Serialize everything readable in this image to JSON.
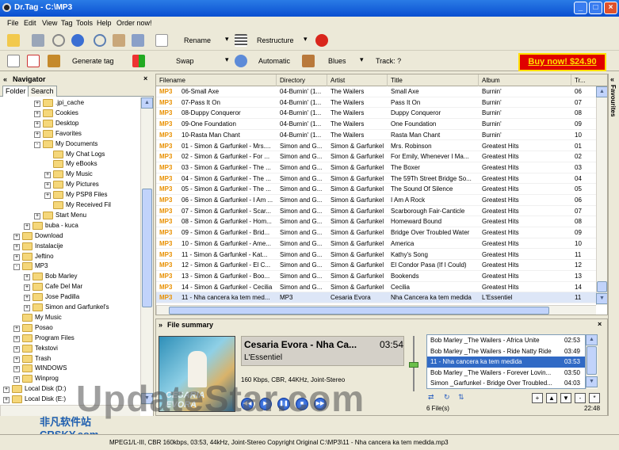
{
  "window": {
    "title": "Dr.Tag - C:\\MP3"
  },
  "menu": [
    "File",
    "Edit",
    "View",
    "Tag",
    "Tools",
    "Help",
    "Order now!"
  ],
  "toolbar": {
    "rename": "Rename",
    "restructure": "Restructure",
    "generate_tag": "Generate tag",
    "swap": "Swap",
    "automatic": "Automatic",
    "genre": "Blues",
    "track": "Track: ?",
    "buy": "Buy now! $24.90"
  },
  "navigator": {
    "title": "Navigator",
    "tab_folder": "Folder",
    "tab_search": "Search",
    "tree": [
      {
        "label": ".jpi_cache",
        "level": 3,
        "exp": "+"
      },
      {
        "label": "Cookies",
        "level": 3,
        "exp": "+"
      },
      {
        "label": "Desktop",
        "level": 3,
        "exp": "+"
      },
      {
        "label": "Favorites",
        "level": 3,
        "exp": "+"
      },
      {
        "label": "My Documents",
        "level": 3,
        "exp": "-"
      },
      {
        "label": "My Chat Logs",
        "level": 4,
        "exp": ""
      },
      {
        "label": "My eBooks",
        "level": 4,
        "exp": ""
      },
      {
        "label": "My Music",
        "level": 4,
        "exp": "+"
      },
      {
        "label": "My Pictures",
        "level": 4,
        "exp": "+"
      },
      {
        "label": "My PSP8 Files",
        "level": 4,
        "exp": "+"
      },
      {
        "label": "My Received Fil",
        "level": 4,
        "exp": ""
      },
      {
        "label": "Start Menu",
        "level": 3,
        "exp": "+"
      },
      {
        "label": "buba - kuca",
        "level": 2,
        "exp": "+"
      },
      {
        "label": "Download",
        "level": 1,
        "exp": "+"
      },
      {
        "label": "Instalacije",
        "level": 1,
        "exp": "+"
      },
      {
        "label": "Jeftino",
        "level": 1,
        "exp": "+"
      },
      {
        "label": "MP3",
        "level": 1,
        "exp": "-"
      },
      {
        "label": "Bob Marley",
        "level": 2,
        "exp": "+"
      },
      {
        "label": "Cafe Del Mar",
        "level": 2,
        "exp": "+"
      },
      {
        "label": "Jose Padilla",
        "level": 2,
        "exp": "+"
      },
      {
        "label": "Simon and Garfunkel's",
        "level": 2,
        "exp": "+"
      },
      {
        "label": "My Music",
        "level": 1,
        "exp": ""
      },
      {
        "label": "Posao",
        "level": 1,
        "exp": "+"
      },
      {
        "label": "Program Files",
        "level": 1,
        "exp": "+"
      },
      {
        "label": "Tekstovi",
        "level": 1,
        "exp": "+"
      },
      {
        "label": "Trash",
        "level": 1,
        "exp": "+"
      },
      {
        "label": "WINDOWS",
        "level": 1,
        "exp": "+"
      },
      {
        "label": "Winprog",
        "level": 1,
        "exp": "+"
      },
      {
        "label": "Local Disk (D:)",
        "level": 0,
        "exp": "+"
      },
      {
        "label": "Local Disk (E:)",
        "level": 0,
        "exp": "+"
      }
    ]
  },
  "grid": {
    "columns": [
      "Filename",
      "Directory",
      "Artist",
      "Title",
      "Album",
      "Tr..."
    ],
    "rows": [
      [
        "06-Small Axe",
        "04-Burnin' (1...",
        "The Wailers",
        "Small Axe",
        "Burnin'",
        "06"
      ],
      [
        "07-Pass It On",
        "04-Burnin' (1...",
        "The Wailers",
        "Pass It On",
        "Burnin'",
        "07"
      ],
      [
        "08-Duppy Conqueror",
        "04-Burnin' (1...",
        "The Wailers",
        "Duppy Conqueror",
        "Burnin'",
        "08"
      ],
      [
        "09-One Foundation",
        "04-Burnin' (1...",
        "The Wailers",
        "One Foundation",
        "Burnin'",
        "09"
      ],
      [
        "10-Rasta Man Chant",
        "04-Burnin' (1...",
        "The Wailers",
        "Rasta Man Chant",
        "Burnin'",
        "10"
      ],
      [
        "01 - Simon & Garfunkel - Mrs....",
        "Simon and G...",
        "Simon & Garfunkel",
        "Mrs. Robinson",
        "Greatest Hits",
        "01"
      ],
      [
        "02 - Simon & Garfunkel - For ...",
        "Simon and G...",
        "Simon & Garfunkel",
        "For Emily, Whenever I Ma...",
        "Greatest Hits",
        "02"
      ],
      [
        "03 - Simon & Garfunkel - The ...",
        "Simon and G...",
        "Simon & Garfunkel",
        "The Boxer",
        "Greatest Hits",
        "03"
      ],
      [
        "04 - Simon & Garfunkel - The ...",
        "Simon and G...",
        "Simon & Garfunkel",
        "The 59Th Street Bridge So...",
        "Greatest Hits",
        "04"
      ],
      [
        "05 - Simon & Garfunkel - The ...",
        "Simon and G...",
        "Simon & Garfunkel",
        "The Sound Of Silence",
        "Greatest Hits",
        "05"
      ],
      [
        "06 - Simon & Garfunkel - I Am ...",
        "Simon and G...",
        "Simon & Garfunkel",
        "I Am A Rock",
        "Greatest Hits",
        "06"
      ],
      [
        "07 - Simon & Garfunkel - Scar...",
        "Simon and G...",
        "Simon & Garfunkel",
        "Scarborough Fair-Canticle",
        "Greatest Hits",
        "07"
      ],
      [
        "08 - Simon & Garfunkel - Hom...",
        "Simon and G...",
        "Simon & Garfunkel",
        "Homeward Bound",
        "Greatest Hits",
        "08"
      ],
      [
        "09 - Simon & Garfunkel - Brid...",
        "Simon and G...",
        "Simon & Garfunkel",
        "Bridge Over Troubled Water",
        "Greatest Hits",
        "09"
      ],
      [
        "10 - Simon & Garfunkel - Ame...",
        "Simon and G...",
        "Simon & Garfunkel",
        "America",
        "Greatest Hits",
        "10"
      ],
      [
        "11 - Simon & Garfunkel - Kat...",
        "Simon and G...",
        "Simon & Garfunkel",
        "Kathy's Song",
        "Greatest Hits",
        "11"
      ],
      [
        "12 - Simon & Garfunkel - El C...",
        "Simon and G...",
        "Simon & Garfunkel",
        "El Condor Pasa (If I Could)",
        "Greatest Hits",
        "12"
      ],
      [
        "13 - Simon & Garfunkel - Boo...",
        "Simon and G...",
        "Simon & Garfunkel",
        "Bookends",
        "Greatest Hits",
        "13"
      ],
      [
        "14 - Simon & Garfunkel - Cecilia",
        "Simon and G...",
        "Simon & Garfunkel",
        "Cecilia",
        "Greatest Hits",
        "14"
      ],
      [
        "11 - Nha cancera ka tem med...",
        "MP3",
        "Cesaria Evora",
        "Nha Cancera ka tem medida",
        "L'Essentiel",
        "11"
      ]
    ],
    "file_tag": "MP3"
  },
  "favorites": "Favourites",
  "file_summary": {
    "title": "File summary",
    "artist_title": "Cesaria Evora - Nha Ca...",
    "duration": "03:54",
    "album": "L'Essentiel",
    "bitrate": "160 Kbps, CBR, 44KHz, Joint-Stereo",
    "cover_text": "CESARIA EVORA"
  },
  "playlist": {
    "items": [
      {
        "title": "Bob Marley _The Wailers - Africa Unite",
        "dur": "02:53"
      },
      {
        "title": "Bob Marley _The Wailers - Ride Natty Ride",
        "dur": "03:49"
      },
      {
        "title": "11 - Nha cancera ka tem medida",
        "dur": "03:53"
      },
      {
        "title": "Bob Marley _The Wailers - Forever Lovin...",
        "dur": "03:50"
      },
      {
        "title": "Simon _Garfunkel - Bridge Over Troubled...",
        "dur": "04:03"
      }
    ],
    "files": "6 File(s)",
    "total": "22:48"
  },
  "status": {
    "text": "MPEG1/L-III, CBR 160kbps, 03:53, 44kHz,  Joint-Stereo  Copyright Original  C:\\MP3\\11 - Nha cancera ka tem medida.mp3"
  },
  "watermark": {
    "text": "UpdateStar.com",
    "sub": "非凡软件站 CRSKY.com"
  }
}
